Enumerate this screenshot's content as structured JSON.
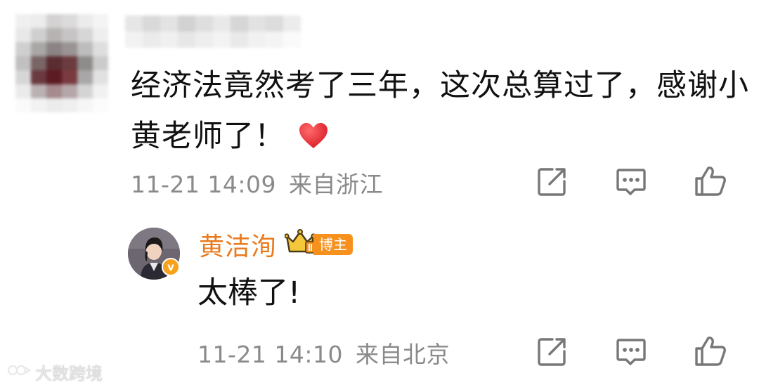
{
  "comment": {
    "text": "经济法竟然考了三年，这次总算过了，感谢小黄老师了！",
    "emoji_icon": "heart-emoji",
    "timestamp": "11-21 14:09",
    "location": "来自浙江"
  },
  "reply": {
    "author": "黄洁洵",
    "role_badge": "博主",
    "verified_icon": "verified-v-badge",
    "crown_icon": "crown-level-icon",
    "text": "太棒了!",
    "timestamp": "11-21 14:10",
    "location": "来自北京"
  },
  "actions": {
    "icons": [
      "share-edit-icon",
      "comment-icon",
      "like-thumb-icon"
    ]
  },
  "watermark": {
    "text": "大数跨境"
  },
  "colors": {
    "accent_name": "#ea7a1e",
    "badge_bg": "#f6911e",
    "meta_gray": "#8a8a8a",
    "heart": "#e8323c"
  }
}
